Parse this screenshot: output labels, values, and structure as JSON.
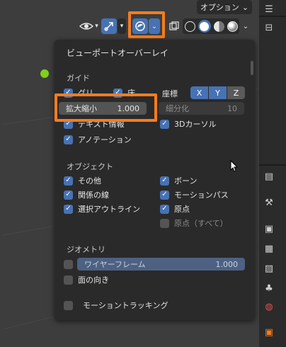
{
  "header": {
    "options_label": "オプション",
    "chevron": "⌄",
    "icons": [
      "visibility-icon",
      "gizmo-icon",
      "overlay-icon",
      "xray-icon",
      "wireframe-shading-icon",
      "solid-shading-icon",
      "material-shading-icon",
      "rendered-shading-icon"
    ]
  },
  "popup": {
    "title": "ビューポートオーバーレイ",
    "guides": {
      "label": "ガイド",
      "grid_label": "グリ",
      "floor_label": "床",
      "axes_label": "座標",
      "axes": [
        "X",
        "Y",
        "Z"
      ],
      "scale_label": "拡大縮小",
      "scale_value": "1.000",
      "subdivisions_label": "細分化",
      "subdivisions_value": "10",
      "text_info_label": "テキスト情報",
      "cursor_label": "3Dカーソル",
      "annotations_label": "アノテーション"
    },
    "objects": {
      "label": "オブジェクト",
      "extras_label": "その他",
      "bones_label": "ボーン",
      "relationship_label": "関係の線",
      "motion_paths_label": "モーションパス",
      "outline_label": "選択アウトライン",
      "origins_label": "原点",
      "origins_all_label": "原点（すべて）"
    },
    "geometry": {
      "label": "ジオメトリ",
      "wireframe_label": "ワイヤーフレーム",
      "wireframe_value": "1.000",
      "face_orientation_label": "面の向き"
    },
    "motion_tracking_label": "モーショントラッキング"
  },
  "colors": {
    "accent": "#4772b3",
    "highlight": "#f57c1f",
    "popup_bg": "#2a2a2a"
  }
}
